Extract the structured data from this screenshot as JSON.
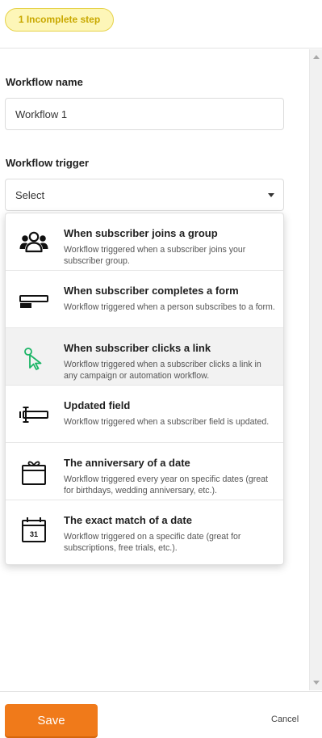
{
  "status_badge": "1 Incomplete step",
  "form": {
    "workflow_name_label": "Workflow name",
    "workflow_name_value": "Workflow 1",
    "workflow_trigger_label": "Workflow trigger",
    "trigger_select_value": "Select"
  },
  "trigger_options": [
    {
      "title": "When subscriber joins a group",
      "description": "Workflow triggered when a subscriber joins your subscriber group.",
      "icon": "group-icon"
    },
    {
      "title": "When subscriber completes a form",
      "description": "Workflow triggered when a person subscribes to a form.",
      "icon": "form-icon"
    },
    {
      "title": "When subscriber clicks a link",
      "description": "Workflow triggered when a subscriber clicks a link in any campaign or automation workflow.",
      "icon": "cursor-click-icon"
    },
    {
      "title": "Updated field",
      "description": "Workflow triggered when a subscriber field is updated.",
      "icon": "text-field-icon"
    },
    {
      "title": "The anniversary of a date",
      "description": "Workflow triggered every year on specific dates (great for birthdays, wedding anniversary, etc.).",
      "icon": "gift-calendar-icon"
    },
    {
      "title": "The exact match of a date",
      "description": "Workflow triggered on a specific date (great for subscriptions, free trials, etc.).",
      "icon": "calendar-icon",
      "icon_text": "31"
    }
  ],
  "footer": {
    "save_label": "Save",
    "cancel_label": "Cancel"
  },
  "colors": {
    "accent": "#f07a1a",
    "badge_bg": "#fdf6b8",
    "badge_text": "#c9a800",
    "link_icon": "#1bb566"
  }
}
